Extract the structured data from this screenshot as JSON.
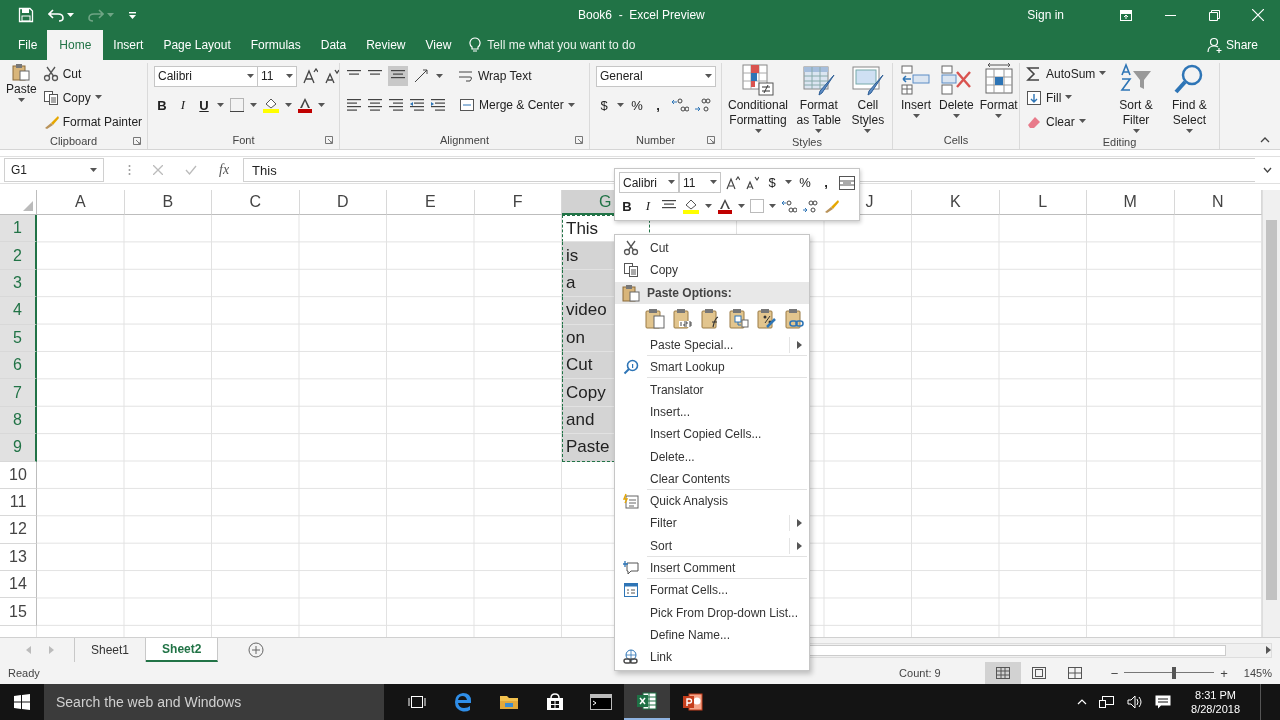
{
  "title_bar": {
    "title": "Book6  -  Excel Preview",
    "sign_in": "Sign in"
  },
  "ribbon_tabs": [
    {
      "label": "File",
      "selected": false
    },
    {
      "label": "Home",
      "selected": true
    },
    {
      "label": "Insert",
      "selected": false
    },
    {
      "label": "Page Layout",
      "selected": false
    },
    {
      "label": "Formulas",
      "selected": false
    },
    {
      "label": "Data",
      "selected": false
    },
    {
      "label": "Review",
      "selected": false
    },
    {
      "label": "View",
      "selected": false
    }
  ],
  "tell_me": {
    "placeholder": "Tell me what you want to do"
  },
  "share": "Share",
  "ribbon_groups": [
    {
      "kind": "clipboard",
      "label": "Clipboard",
      "large": "Paste",
      "small": [
        "Cut",
        "Copy",
        "Format Painter"
      ]
    },
    {
      "kind": "font",
      "label": "Font",
      "font_name": "Calibri",
      "font_size": "11",
      "style_buttons": [
        "B",
        "I",
        "U"
      ]
    },
    {
      "kind": "alignment",
      "label": "Alignment",
      "wrap": "Wrap Text",
      "merge": "Merge & Center"
    },
    {
      "kind": "number",
      "label": "Number",
      "format": "General",
      "symbols": [
        "$",
        "%",
        ","
      ]
    },
    {
      "kind": "large",
      "label": "Styles",
      "buttons": [
        "Conditional Formatting",
        "Format as Table",
        "Cell Styles"
      ]
    },
    {
      "kind": "large",
      "label": "Cells",
      "buttons": [
        "Insert",
        "Delete",
        "Format"
      ]
    },
    {
      "kind": "editing",
      "label": "Editing",
      "small": [
        "AutoSum",
        "Fill",
        "Clear"
      ],
      "large": [
        "Sort & Filter",
        "Find & Select"
      ]
    }
  ],
  "formula_bar": {
    "name_box": "G1",
    "function_label": "fx",
    "value": "This"
  },
  "columns_left": [
    {
      "label": "A",
      "selected": false
    },
    {
      "label": "B",
      "selected": false
    },
    {
      "label": "C",
      "selected": false
    },
    {
      "label": "D",
      "selected": false
    },
    {
      "label": "E",
      "selected": false
    },
    {
      "label": "F",
      "selected": false
    },
    {
      "label": "G",
      "selected": true
    }
  ],
  "columns_right": [
    {
      "label": "J",
      "selected": false
    },
    {
      "label": "K",
      "selected": false
    },
    {
      "label": "L",
      "selected": false
    },
    {
      "label": "M",
      "selected": false
    },
    {
      "label": "N",
      "selected": false
    }
  ],
  "rows": [
    {
      "label": "1",
      "selected": true,
      "g": "This"
    },
    {
      "label": "2",
      "selected": true,
      "g": "is"
    },
    {
      "label": "3",
      "selected": true,
      "g": "a"
    },
    {
      "label": "4",
      "selected": true,
      "g": "video"
    },
    {
      "label": "5",
      "selected": true,
      "g": "on"
    },
    {
      "label": "6",
      "selected": true,
      "g": "Cut"
    },
    {
      "label": "7",
      "selected": true,
      "g": "Copy"
    },
    {
      "label": "8",
      "selected": true,
      "g": "and"
    },
    {
      "label": "9",
      "selected": true,
      "g": "Paste"
    },
    {
      "label": "10",
      "selected": false
    },
    {
      "label": "11",
      "selected": false
    },
    {
      "label": "12",
      "selected": false
    },
    {
      "label": "13",
      "selected": false
    },
    {
      "label": "14",
      "selected": false
    },
    {
      "label": "15",
      "selected": false
    }
  ],
  "mini_toolbar": {
    "font_name": "Calibri",
    "font_size": "11",
    "symbols": [
      "$",
      "%",
      ","
    ],
    "style_buttons": [
      "B",
      "I"
    ]
  },
  "context_menu": [
    {
      "kind": "item",
      "label": "Cut",
      "submenu": false,
      "separator_after": false
    },
    {
      "kind": "item",
      "label": "Copy",
      "submenu": false,
      "separator_after": false
    },
    {
      "kind": "header",
      "label": "Paste Options:"
    },
    {
      "kind": "paste-row"
    },
    {
      "kind": "item",
      "label": "Paste Special...",
      "submenu": true,
      "separator_after": true
    },
    {
      "kind": "item",
      "label": "Smart Lookup",
      "submenu": false,
      "separator_after": true
    },
    {
      "kind": "item",
      "label": "Translator",
      "submenu": false,
      "separator_after": false
    },
    {
      "kind": "item",
      "label": "Insert...",
      "submenu": false,
      "separator_after": false
    },
    {
      "kind": "item",
      "label": "Insert Copied Cells...",
      "submenu": false,
      "separator_after": false
    },
    {
      "kind": "item",
      "label": "Delete...",
      "submenu": false,
      "separator_after": false
    },
    {
      "kind": "item",
      "label": "Clear Contents",
      "submenu": false,
      "separator_after": true
    },
    {
      "kind": "item",
      "label": "Quick Analysis",
      "submenu": false,
      "separator_after": false
    },
    {
      "kind": "item",
      "label": "Filter",
      "submenu": true,
      "separator_after": false
    },
    {
      "kind": "item",
      "label": "Sort",
      "submenu": true,
      "separator_after": true
    },
    {
      "kind": "item",
      "label": "Insert Comment",
      "submenu": false,
      "separator_after": true
    },
    {
      "kind": "item",
      "label": "Format Cells...",
      "submenu": false,
      "separator_after": false
    },
    {
      "kind": "item",
      "label": "Pick From Drop-down List...",
      "submenu": false,
      "separator_after": false
    },
    {
      "kind": "item",
      "label": "Define Name...",
      "submenu": false,
      "separator_after": false
    },
    {
      "kind": "item",
      "label": "Link",
      "submenu": false,
      "separator_after": false
    }
  ],
  "sheet_tabs": [
    {
      "label": "Sheet1",
      "selected": false
    },
    {
      "label": "Sheet2",
      "selected": true
    }
  ],
  "status_bar": {
    "status": "Ready",
    "count": "Count: 9",
    "views": [
      {
        "kind": "normal",
        "selected": true
      },
      {
        "kind": "layout",
        "selected": false
      },
      {
        "kind": "break",
        "selected": false
      }
    ],
    "zoom": {
      "level": 0.55,
      "reading": "145%",
      "minus": "−",
      "plus": "+"
    }
  },
  "taskbar": {
    "search": {
      "placeholder": "Search the web and Windows"
    },
    "time": "8:31 PM",
    "date": "8/28/2018"
  }
}
